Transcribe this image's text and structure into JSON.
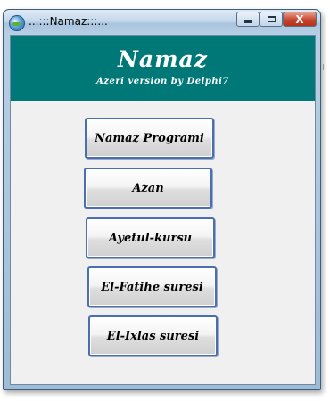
{
  "window": {
    "title": "...:::Namaz:::...",
    "controls": {
      "minimize": "minimize",
      "maximize": "maximize",
      "close": "X"
    }
  },
  "banner": {
    "title": "Namaz",
    "subtitle": "Azeri version by Delphi7"
  },
  "buttons": [
    {
      "label": "Namaz Programi"
    },
    {
      "label": "Azan"
    },
    {
      "label": "Ayetul-kursu"
    },
    {
      "label": "El-Fatihe suresi"
    },
    {
      "label": "El-Ixlas suresi"
    }
  ],
  "colors": {
    "banner_bg": "#007878",
    "client_bg": "#f0f0f0",
    "button_border": "#4a6fb0"
  },
  "icons": {
    "app": "globe-icon",
    "minimize": "minimize-icon",
    "maximize": "maximize-icon",
    "close": "close-icon"
  }
}
